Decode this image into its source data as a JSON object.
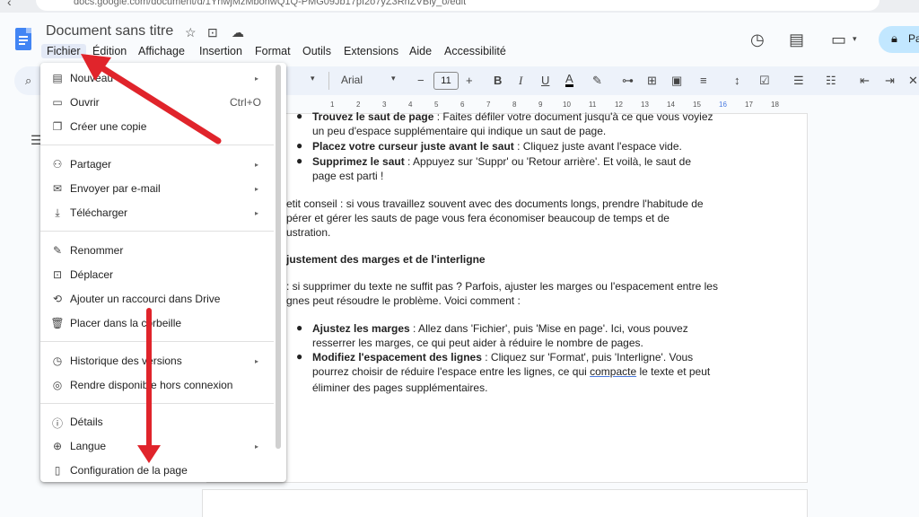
{
  "browser": {
    "url": "docs.google.com/document/d/1YhwjMzMbohwQ1Q-PMG09Jb17pI2o7yZ3RnZVBly_o/edit"
  },
  "header": {
    "doc_title": "Document sans titre",
    "menus": [
      "Fichier",
      "Édition",
      "Affichage",
      "Insertion",
      "Format",
      "Outils",
      "Extensions",
      "Aide",
      "Accessibilité"
    ],
    "share_label": "Pa"
  },
  "toolbar": {
    "font_name": "Arial",
    "font_size": "11"
  },
  "ruler": [
    "1",
    "2",
    "3",
    "4",
    "5",
    "6",
    "7",
    "8",
    "9",
    "10",
    "11",
    "12",
    "13",
    "14",
    "15",
    "16",
    "17",
    "18"
  ],
  "file_menu": {
    "items": [
      {
        "icon": "new-doc-icon",
        "label": "Nouveau",
        "submenu": true
      },
      {
        "icon": "folder-icon",
        "label": "Ouvrir",
        "shortcut": "Ctrl+O"
      },
      {
        "icon": "copy-icon",
        "label": "Créer une copie"
      },
      {
        "icon": "person-add-icon",
        "label": "Partager",
        "submenu": true
      },
      {
        "icon": "mail-icon",
        "label": "Envoyer par e-mail",
        "submenu": true
      },
      {
        "icon": "download-icon",
        "label": "Télécharger",
        "submenu": true
      },
      {
        "icon": "pencil-icon",
        "label": "Renommer"
      },
      {
        "icon": "move-icon",
        "label": "Déplacer"
      },
      {
        "icon": "drive-shortcut-icon",
        "label": "Ajouter un raccourci dans Drive"
      },
      {
        "icon": "trash-icon",
        "label": "Placer dans la corbeille"
      },
      {
        "icon": "history-icon",
        "label": "Historique des versions",
        "submenu": true
      },
      {
        "icon": "offline-icon",
        "label": "Rendre disponible hors connexion"
      },
      {
        "icon": "info-icon",
        "label": "Détails"
      },
      {
        "icon": "globe-icon",
        "label": "Langue",
        "submenu": true
      },
      {
        "icon": "page-setup-icon",
        "label": "Configuration de la page"
      }
    ]
  },
  "document": {
    "b1_bold": "Trouvez le saut de page",
    "b1_rest": " : Faites défiler votre document jusqu'à ce que vous voyiez",
    "b1_line2": "un peu d'espace supplémentaire qui indique un saut de page.",
    "b2_bold": "Placez votre curseur juste avant le saut",
    "b2_rest": " : Cliquez juste avant l'espace vide.",
    "b3_bold": "Supprimez le saut",
    "b3_rest": " : Appuyez sur 'Suppr' ou 'Retour arrière'. Et voilà, le saut de",
    "b3_line2": "page est parti !",
    "p1_l1": "etit conseil : si vous travaillez souvent avec des documents longs, prendre l'habitude de",
    "p1_l2": "pérer et gérer les sauts de page vous fera économiser beaucoup de temps et de",
    "p1_l3": "ustration.",
    "heading": "justement des marges et de l'interligne",
    "p2_l1": ": si supprimer du texte ne suffit pas ? Parfois, ajuster les marges ou l'espacement entre les",
    "p2_l2": "gnes peut résoudre le problème. Voici comment :",
    "b4_bold": "Ajustez les marges",
    "b4_rest": " : Allez dans 'Fichier', puis 'Mise en page'. Ici, vous pouvez",
    "b4_line2": "resserrer les marges, ce qui peut aider à réduire le nombre de pages.",
    "b5_bold": "Modifiez l'espacement des lignes",
    "b5_rest": " : Cliquez sur 'Format', puis 'Interligne'. Vous",
    "b5_line2_a": "pourrez choisir de réduire l'espace entre les lignes, ce qui ",
    "b5_line2_u": "compacte",
    "b5_line2_b": " le texte et peut",
    "b5_line3": "éliminer des pages supplémentaires."
  },
  "colors": {
    "annotation_arrow": "#e0242b",
    "menu_highlight": "#e3e9f6",
    "share_bg": "#c2e7ff"
  }
}
